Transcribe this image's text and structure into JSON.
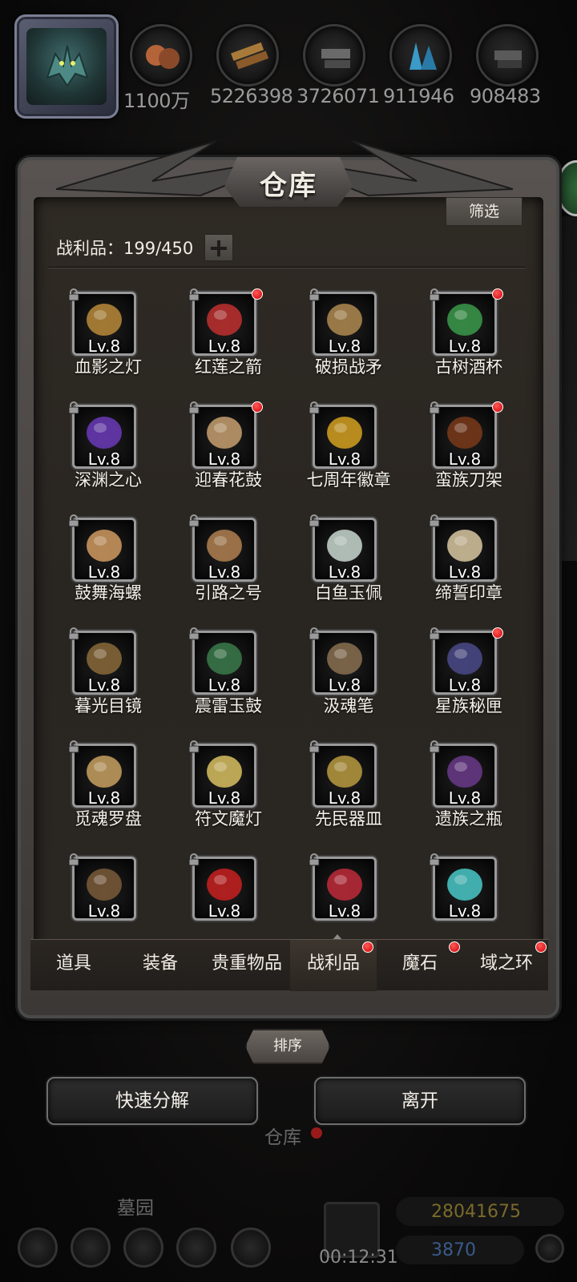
{
  "resources": [
    {
      "icon": "copper-ore-icon",
      "value": "1100万"
    },
    {
      "icon": "wood-planks-icon",
      "value": "5226398"
    },
    {
      "icon": "iron-ingot-icon",
      "value": "3726071"
    },
    {
      "icon": "crystal-icon",
      "value": "911946"
    },
    {
      "icon": "stone-icon",
      "value": "908483"
    }
  ],
  "panel": {
    "title": "仓库",
    "filter_label": "筛选",
    "capacity_label": "战利品：199/450",
    "sort_label": "排序"
  },
  "items": [
    {
      "name": "血影之灯",
      "level": "Lv.8",
      "new": false,
      "icon": "lantern-icon"
    },
    {
      "name": "红莲之箭",
      "level": "Lv.8",
      "new": true,
      "icon": "red-arrow-icon"
    },
    {
      "name": "破损战矛",
      "level": "Lv.8",
      "new": false,
      "icon": "broken-spear-icon"
    },
    {
      "name": "古树酒杯",
      "level": "Lv.8",
      "new": true,
      "icon": "goblet-icon"
    },
    {
      "name": "深渊之心",
      "level": "Lv.8",
      "new": false,
      "icon": "abyss-orb-icon"
    },
    {
      "name": "迎春花鼓",
      "level": "Lv.8",
      "new": true,
      "icon": "drum-icon"
    },
    {
      "name": "七周年徽章",
      "level": "Lv.8",
      "new": false,
      "icon": "anniversary-badge-vii-icon"
    },
    {
      "name": "蛮族刀架",
      "level": "Lv.8",
      "new": true,
      "icon": "antler-rack-icon"
    },
    {
      "name": "鼓舞海螺",
      "level": "Lv.8",
      "new": false,
      "icon": "conch-shell-icon"
    },
    {
      "name": "引路之号",
      "level": "Lv.8",
      "new": false,
      "icon": "horn-icon"
    },
    {
      "name": "白鱼玉佩",
      "level": "Lv.8",
      "new": false,
      "icon": "jade-fish-pendant-icon"
    },
    {
      "name": "缔誓印章",
      "level": "Lv.8",
      "new": false,
      "icon": "seal-stamp-icon"
    },
    {
      "name": "暮光目镜",
      "level": "Lv.8",
      "new": false,
      "icon": "goggles-icon"
    },
    {
      "name": "震雷玉鼓",
      "level": "Lv.8",
      "new": false,
      "icon": "jade-drum-icon"
    },
    {
      "name": "汲魂笔",
      "level": "Lv.8",
      "new": false,
      "icon": "soul-brush-icon"
    },
    {
      "name": "星族秘匣",
      "level": "Lv.8",
      "new": true,
      "icon": "star-box-icon"
    },
    {
      "name": "觅魂罗盘",
      "level": "Lv.8",
      "new": false,
      "icon": "compass-icon"
    },
    {
      "name": "符文魔灯",
      "level": "Lv.8",
      "new": false,
      "icon": "rune-lamp-icon"
    },
    {
      "name": "先民器皿",
      "level": "Lv.8",
      "new": false,
      "icon": "ancient-bowl-icon"
    },
    {
      "name": "遗族之瓶",
      "level": "Lv.8",
      "new": false,
      "icon": "relic-vase-icon"
    },
    {
      "name": "",
      "level": "Lv.8",
      "new": false,
      "icon": "staff-icon"
    },
    {
      "name": "",
      "level": "Lv.8",
      "new": false,
      "icon": "anniversary-badge-viii-icon"
    },
    {
      "name": "",
      "level": "Lv.8",
      "new": false,
      "icon": "red-blue-wand-icon"
    },
    {
      "name": "",
      "level": "Lv.8",
      "new": false,
      "icon": "crystal-key-icon"
    }
  ],
  "tabs": [
    {
      "label": "道具",
      "dot": false,
      "active": false
    },
    {
      "label": "装备",
      "dot": false,
      "active": false
    },
    {
      "label": "贵重物品",
      "dot": false,
      "active": false
    },
    {
      "label": "战利品",
      "dot": true,
      "active": true
    },
    {
      "label": "魔石",
      "dot": true,
      "active": false
    },
    {
      "label": "域之环",
      "dot": true,
      "active": false
    }
  ],
  "buttons": {
    "decompose": "快速分解",
    "leave": "离开"
  },
  "background": {
    "warehouse_label": "仓库",
    "graveyard_label": "墓园",
    "timer": "00:12:31",
    "gold": "28041675",
    "gems": "3870"
  },
  "colors": {
    "red_dot": "#d10000",
    "gold_text": "#8a6a1a",
    "gem_text": "#3a5a8a"
  }
}
